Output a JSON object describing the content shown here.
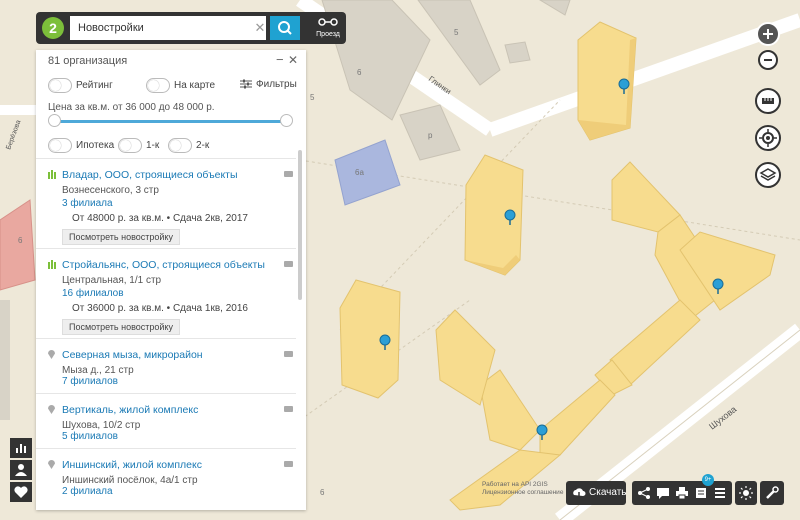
{
  "search": {
    "value": "Новостройки",
    "route_label": "Проезд"
  },
  "panel": {
    "count": "81 организация",
    "toggles": {
      "rating": "Рейтинг",
      "on_map": "На карте",
      "filters": "Фильтры"
    },
    "price": "Цена за кв.м. от 36 000 до 48 000 р.",
    "options": {
      "mortgage": "Ипотека",
      "one_room": "1-к",
      "two_room": "2-к"
    },
    "results": [
      {
        "title": "Владар, ООО, строящиеся объекты",
        "address": "Вознесенского, 3 стр",
        "branches": "3 филиала",
        "offer": "От 48000 р. за кв.м. • Сдача 2кв, 2017",
        "button": "Посмотреть новостройку"
      },
      {
        "title": "Стройальянс, ООО, строящиеся объекты",
        "address": "Центральная, 1/1 стр",
        "branches": "16 филиалов",
        "offer": "От 36000 р. за кв.м. • Сдача 1кв, 2016",
        "button": "Посмотреть новостройку"
      },
      {
        "title": "Северная мыза, микрорайон",
        "address": "Мыза д., 21 стр",
        "branches": "7 филиалов"
      },
      {
        "title": "Вертикаль, жилой комплекс",
        "address": "Шухова, 10/2 стр",
        "branches": "5 филиалов"
      },
      {
        "title": "Иншинский, жилой комплекс",
        "address": "Иншинский посёлок, 4а/1 стр",
        "branches": "2 филиала"
      }
    ]
  },
  "map": {
    "street_glinki": "Глинки",
    "street_shukhova": "Шухова",
    "street_berezova": "Берёзова",
    "labels": [
      "5",
      "6",
      "5",
      "р",
      "6а",
      "6",
      "6"
    ],
    "attribution": [
      "Работает на API 2GIS",
      "Лицензионное соглашение"
    ],
    "download": "Скачать",
    "badge": "9+"
  },
  "colors": {
    "accent": "#1fa2d1",
    "brand_green": "#7cbf3a",
    "building": "#f7dc8e",
    "road": "#ffffff"
  }
}
